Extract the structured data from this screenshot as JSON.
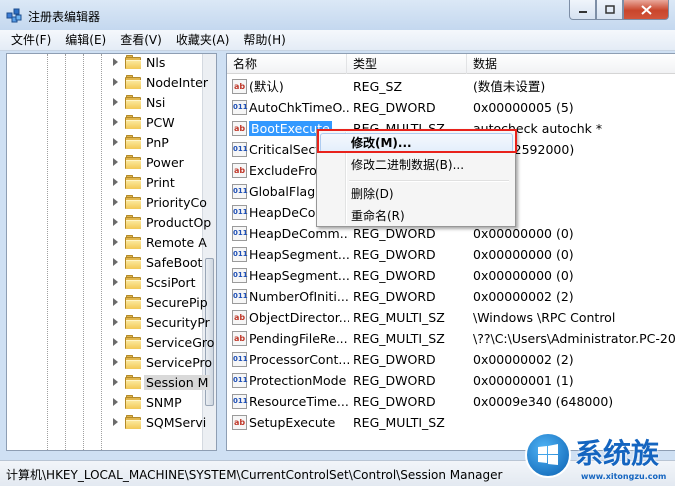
{
  "window": {
    "title": "注册表编辑器"
  },
  "menu": [
    "文件(F)",
    "编辑(E)",
    "查看(V)",
    "收藏夹(A)",
    "帮助(H)"
  ],
  "tree": {
    "items": [
      "Nls",
      "NodeInter",
      "Nsi",
      "PCW",
      "PnP",
      "Power",
      "Print",
      "PriorityCo",
      "ProductOp",
      "Remote A",
      "SafeBoot",
      "ScsiPort",
      "SecurePip",
      "SecurityPr",
      "ServiceGro",
      "ServicePro",
      "Session M",
      "SNMP",
      "SQMServi"
    ],
    "selected_index": 16
  },
  "list": {
    "columns": {
      "name": "名称",
      "type": "类型",
      "data": "数据"
    },
    "rows": [
      {
        "icon": "ab",
        "name": "(默认)",
        "type": "REG_SZ",
        "data": "(数值未设置)"
      },
      {
        "icon": "num",
        "name": "AutoChkTimeO...",
        "type": "REG_DWORD",
        "data": "0x00000005 (5)"
      },
      {
        "icon": "ab",
        "name": "BootExecute",
        "type": "REG_MULTI_SZ",
        "data": "autocheck autochk *"
      },
      {
        "icon": "num",
        "name": "CriticalSecti",
        "type": "",
        "data": "3d00 (2592000)"
      },
      {
        "icon": "ab",
        "name": "ExcludeFron",
        "type": "",
        "data": ""
      },
      {
        "icon": "num",
        "name": "GlobalFlag",
        "type": "",
        "data": "0000"
      },
      {
        "icon": "num",
        "name": "HeapDeCom",
        "type": "",
        "data": "0000"
      },
      {
        "icon": "num",
        "name": "HeapDeComm...",
        "type": "REG_DWORD",
        "data": "0x00000000 (0)"
      },
      {
        "icon": "num",
        "name": "HeapSegment...",
        "type": "REG_DWORD",
        "data": "0x00000000 (0)"
      },
      {
        "icon": "num",
        "name": "HeapSegment...",
        "type": "REG_DWORD",
        "data": "0x00000000 (0)"
      },
      {
        "icon": "num",
        "name": "NumberOfIniti...",
        "type": "REG_DWORD",
        "data": "0x00000002 (2)"
      },
      {
        "icon": "ab",
        "name": "ObjectDirector...",
        "type": "REG_MULTI_SZ",
        "data": "\\Windows \\RPC Control"
      },
      {
        "icon": "ab",
        "name": "PendingFileRe...",
        "type": "REG_MULTI_SZ",
        "data": "\\??\\C:\\Users\\Administrator.PC-201"
      },
      {
        "icon": "num",
        "name": "ProcessorCont...",
        "type": "REG_DWORD",
        "data": "0x00000002 (2)"
      },
      {
        "icon": "num",
        "name": "ProtectionMode",
        "type": "REG_DWORD",
        "data": "0x00000001 (1)"
      },
      {
        "icon": "num",
        "name": "ResourceTime...",
        "type": "REG_DWORD",
        "data": "0x0009e340 (648000)"
      },
      {
        "icon": "ab",
        "name": "SetupExecute",
        "type": "REG_MULTI_SZ",
        "data": ""
      }
    ],
    "selected_index": 2
  },
  "context_menu": {
    "items": [
      "修改(M)...",
      "修改二进制数据(B)...",
      "删除(D)",
      "重命名(R)"
    ]
  },
  "status": {
    "path": "计算机\\HKEY_LOCAL_MACHINE\\SYSTEM\\CurrentControlSet\\Control\\Session Manager"
  },
  "watermark": {
    "text": "系统族",
    "url": "www.xitongzu.com"
  },
  "colors": {
    "selection": "#3399ff",
    "highlight_box": "#e8221b",
    "folder": "#f2c957"
  }
}
